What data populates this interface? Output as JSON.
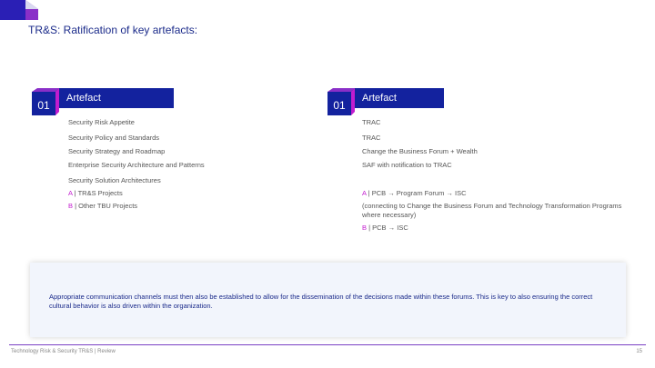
{
  "title": "TR&S: Ratification of key artefacts:",
  "left_panel": {
    "badge": "01",
    "header": "Artefact",
    "items": [
      "Security Risk Appetite",
      "Security Policy and Standards",
      "Security Strategy and Roadmap",
      "Enterprise Security Architecture and Patterns",
      "Security Solution Architectures"
    ],
    "sub_items": [
      {
        "tag": "A",
        "sep": " | ",
        "text": "TR&S Projects"
      },
      {
        "tag": "B",
        "sep": " | ",
        "text": "Other TBU Projects"
      }
    ]
  },
  "right_panel": {
    "badge": "01",
    "header": "Artefact",
    "items": [
      "TRAC",
      "TRAC",
      "Change the Business Forum + Wealth",
      "SAF with notification to TRAC"
    ],
    "sub_a": {
      "tag": "A",
      "sep": " | ",
      "text": "PCB → Program Forum → ISC"
    },
    "sub_a_note": "(connecting to Change the Business Forum and Technology Transformation Programs where necessary)",
    "sub_b": {
      "tag": "B",
      "sep": " | ",
      "text": "PCB → ISC"
    }
  },
  "note": "Appropriate communication channels must then also be established to allow for the dissemination of the decisions made within these forums. This is key to also ensuring the correct cultural behavior is also driven within the organization.",
  "footer": {
    "text": "Technology Risk & Security TR&S | Review",
    "page": "15"
  },
  "colors": {
    "brand_blue": "#13229e",
    "accent_magenta": "#c21ccf",
    "title_blue": "#1a2a8a"
  }
}
